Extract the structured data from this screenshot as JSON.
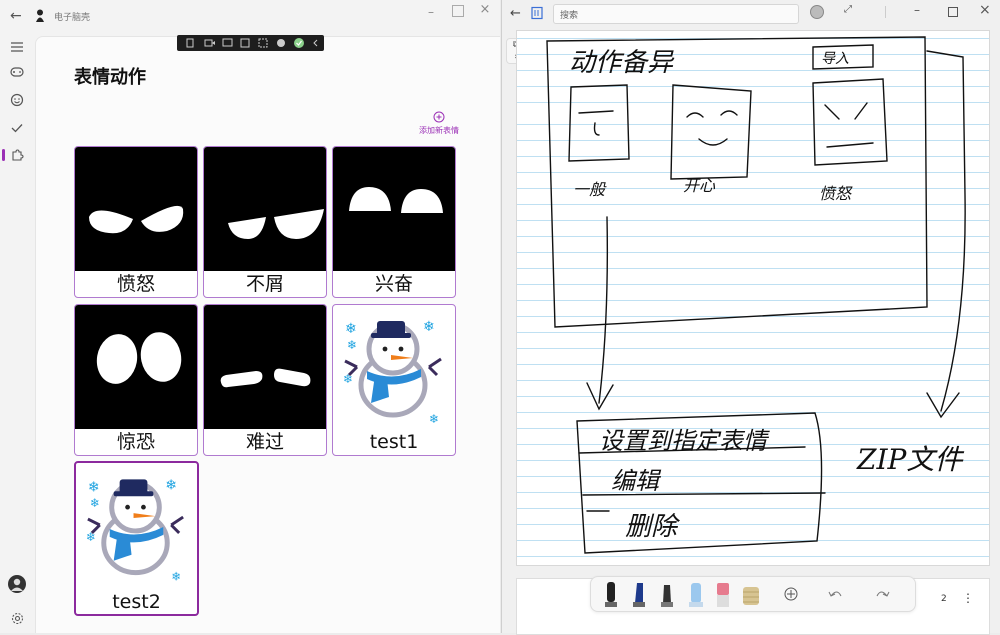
{
  "left_app": {
    "title": "电子脑壳",
    "page_title": "表情动作",
    "add_button_label": "添加新表情",
    "cards": [
      {
        "label": "愤怒",
        "type": "eyes",
        "variant": "angry"
      },
      {
        "label": "不屑",
        "type": "eyes",
        "variant": "disdain"
      },
      {
        "label": "兴奋",
        "type": "eyes",
        "variant": "excited"
      },
      {
        "label": "惊恐",
        "type": "eyes",
        "variant": "scared"
      },
      {
        "label": "难过",
        "type": "eyes",
        "variant": "sad"
      },
      {
        "label": "test1",
        "type": "snowman"
      },
      {
        "label": "test2",
        "type": "snowman",
        "selected": true
      }
    ],
    "colors": {
      "accent": "#9b30b6",
      "card_border": "#b07ad0",
      "selected_border": "#8c2a9e"
    }
  },
  "right_app": {
    "search_placeholder": "搜索",
    "page_number": "2",
    "sketch_text": {
      "heading": "动作备异",
      "badge": "导入",
      "face1": "一般",
      "face2": "开心",
      "face3": "愤怒",
      "menu1": "设置到指定表情",
      "menu2": "编辑",
      "menu3": "删除",
      "zip": "ZIP文件"
    }
  }
}
